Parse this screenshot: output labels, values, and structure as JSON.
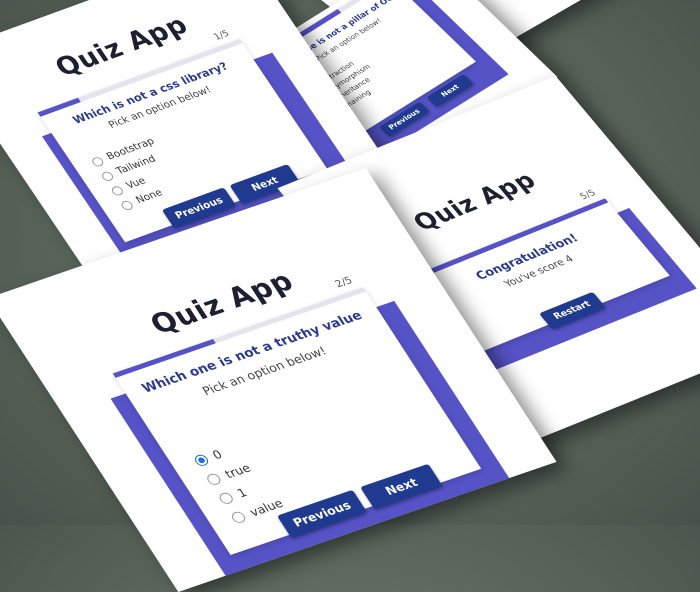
{
  "app_title": "Quiz App",
  "screens": {
    "q1": {
      "counter": "1/5",
      "question": "Which is not a css library?",
      "hint": "Pick an option below!",
      "options": [
        "Bootstrap",
        "Tailwind",
        "Vue",
        "None"
      ],
      "previous_label": "Previous",
      "next_label": "Next",
      "progress_fraction": 0.2
    },
    "q2": {
      "counter": "2/5",
      "question": "Which one is not a truthy value",
      "hint": "Pick an option below!",
      "options": [
        "0",
        "true",
        "1",
        "value"
      ],
      "selected_index": 0,
      "previous_label": "Previous",
      "next_label": "Next",
      "progress_fraction": 0.4
    },
    "q3": {
      "question": "Which one is not a pillar of OOP?",
      "hint": "Pick an option below!",
      "options": [
        "Abstraction",
        "Polymorphism",
        "Inheritance",
        "Chaining"
      ],
      "selected_index": 3,
      "previous_label": "Previous",
      "next_label": "Next",
      "progress_fraction": 0.6
    },
    "result": {
      "counter": "5/5",
      "title": "Congratulation!",
      "score_text": "You've score 4",
      "restart_label": "Restart",
      "progress_fraction": 1.0
    }
  },
  "colors": {
    "accent_purple": "#5553c6",
    "button_navy": "#1f3a8f",
    "question_blue": "#2b3a8f",
    "radio_checked": "#1e6fe0"
  }
}
